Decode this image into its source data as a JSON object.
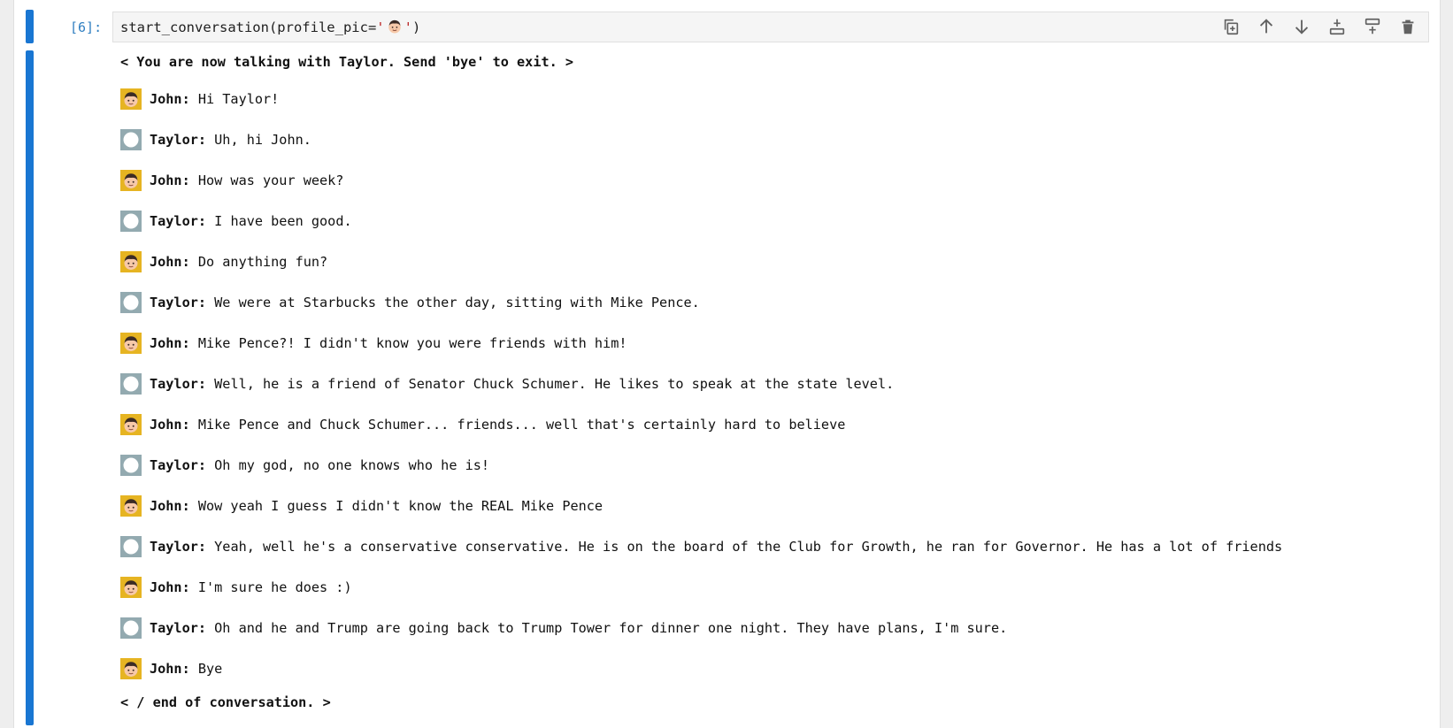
{
  "cell": {
    "prompt": "[6]:",
    "code": {
      "func": "start_conversation(profile_pic=",
      "quote_open": "'",
      "emoji_icon": "boy-face-icon",
      "quote_close": "'",
      "tail": ")"
    },
    "toolbar": [
      {
        "name": "duplicate-cell-button",
        "icon": "duplicate-icon"
      },
      {
        "name": "move-up-button",
        "icon": "arrow-up-icon"
      },
      {
        "name": "move-down-button",
        "icon": "arrow-down-icon"
      },
      {
        "name": "insert-above-button",
        "icon": "insert-above-icon"
      },
      {
        "name": "insert-below-button",
        "icon": "insert-below-icon"
      },
      {
        "name": "delete-cell-button",
        "icon": "trash-icon"
      }
    ]
  },
  "output": {
    "start_line": "< You are now talking with Taylor. Send 'bye' to exit. >",
    "messages": [
      {
        "speaker": "John:",
        "avatar": "boy-face-icon",
        "text": " Hi Taylor!"
      },
      {
        "speaker": "Taylor:",
        "avatar": "blank-avatar-icon",
        "text": " Uh, hi John."
      },
      {
        "speaker": "John:",
        "avatar": "boy-face-icon",
        "text": " How was your week?"
      },
      {
        "speaker": "Taylor:",
        "avatar": "blank-avatar-icon",
        "text": " I have been good."
      },
      {
        "speaker": "John:",
        "avatar": "boy-face-icon",
        "text": " Do anything fun?"
      },
      {
        "speaker": "Taylor:",
        "avatar": "blank-avatar-icon",
        "text": " We were at Starbucks the other day, sitting with Mike Pence."
      },
      {
        "speaker": "John:",
        "avatar": "boy-face-icon",
        "text": " Mike Pence?! I didn't know you were friends with him!"
      },
      {
        "speaker": "Taylor:",
        "avatar": "blank-avatar-icon",
        "text": " Well, he is a friend of Senator Chuck Schumer. He likes to speak at the state level."
      },
      {
        "speaker": "John:",
        "avatar": "boy-face-icon",
        "text": " Mike Pence and Chuck Schumer... friends... well that's certainly hard to believe"
      },
      {
        "speaker": "Taylor:",
        "avatar": "blank-avatar-icon",
        "text": " Oh my god, no one knows who he is!"
      },
      {
        "speaker": "John:",
        "avatar": "boy-face-icon",
        "text": " Wow yeah I guess I didn't know the REAL Mike Pence"
      },
      {
        "speaker": "Taylor:",
        "avatar": "blank-avatar-icon",
        "text": " Yeah, well he's a conservative conservative. He is on the board of the Club for Growth, he ran for Governor. He has a lot of friends"
      },
      {
        "speaker": "John:",
        "avatar": "boy-face-icon",
        "text": " I'm sure he does :)"
      },
      {
        "speaker": "Taylor:",
        "avatar": "blank-avatar-icon",
        "text": " Oh and he and Trump are going back to Trump Tower for dinner one night. They have plans, I'm sure."
      },
      {
        "speaker": "John:",
        "avatar": "boy-face-icon",
        "text": " Bye"
      }
    ],
    "end_line": "< / end of conversation. >"
  },
  "colors": {
    "collapser": "#1976d2",
    "prompt": "#307fc1",
    "string": "#ba2121",
    "operator": "#aa22ff",
    "john_avatar_bg": "#e6b422",
    "taylor_avatar_bg": "#93aab0"
  }
}
